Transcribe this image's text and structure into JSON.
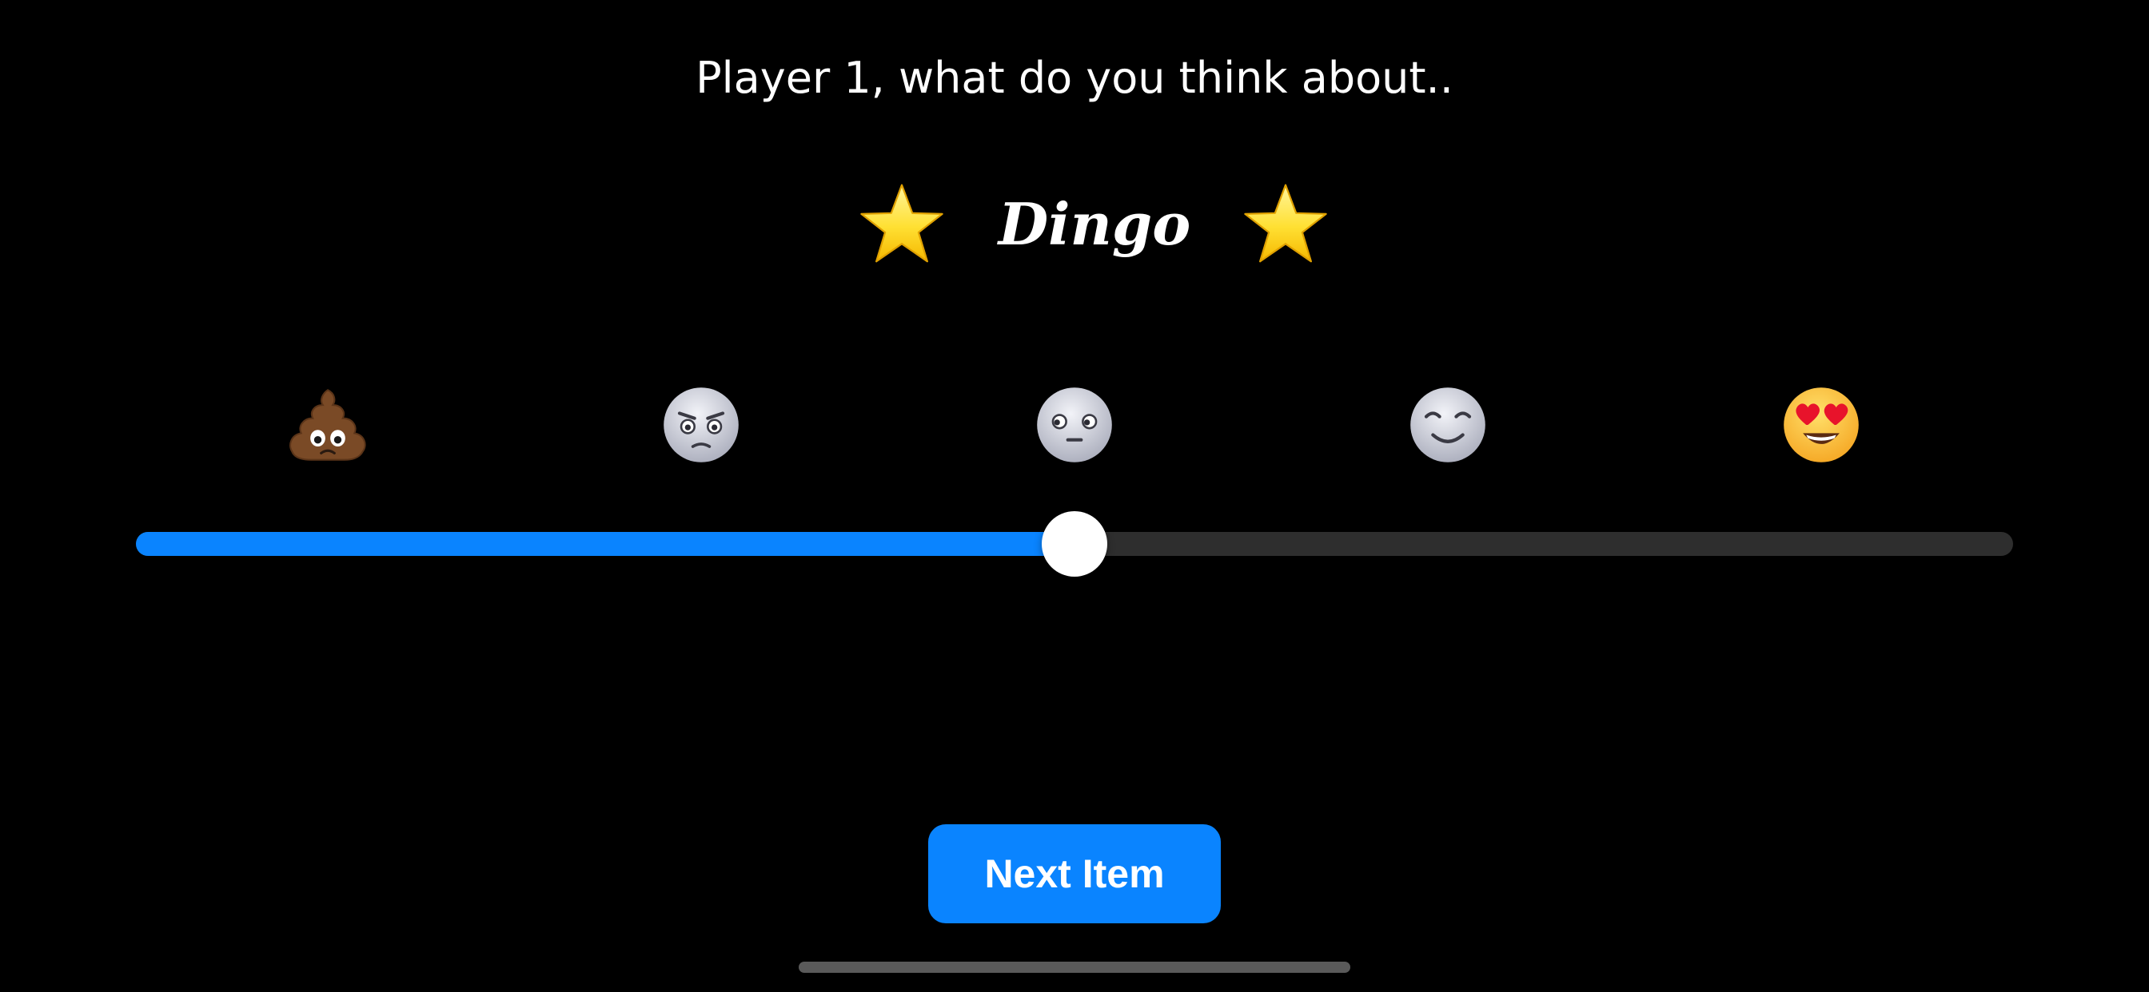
{
  "prompt": {
    "text": "Player 1, what do you think about.."
  },
  "item": {
    "name": "Dingo",
    "left_icon": "star-icon",
    "right_icon": "star-icon"
  },
  "rating_scale": {
    "faces": [
      {
        "icon": "pile-of-poo-icon"
      },
      {
        "icon": "angry-face-icon"
      },
      {
        "icon": "neutral-face-icon"
      },
      {
        "icon": "smiling-face-icon"
      },
      {
        "icon": "heart-eyes-face-icon"
      }
    ]
  },
  "slider": {
    "value": 0.5,
    "min": 0,
    "max": 1,
    "fill_color": "#0a84ff",
    "track_color": "#2e2e2e",
    "thumb_color": "#ffffff"
  },
  "actions": {
    "next_label": "Next Item",
    "button_color": "#0a84ff"
  }
}
